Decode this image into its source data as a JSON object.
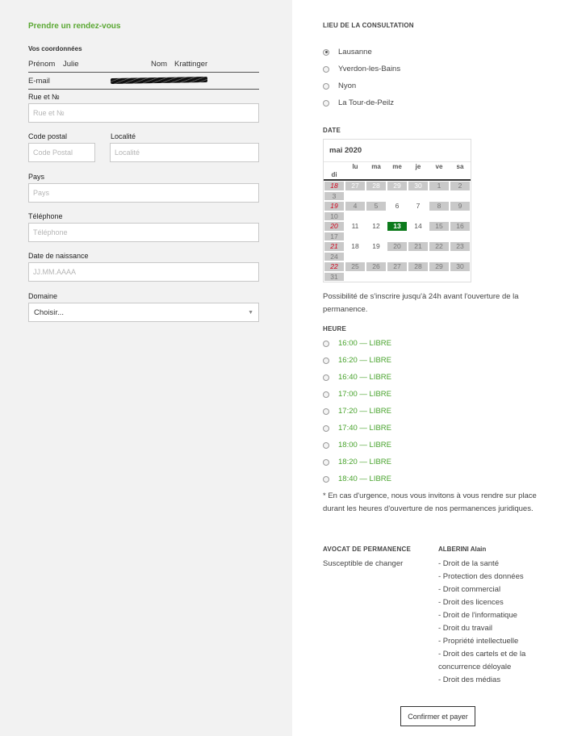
{
  "form": {
    "title": "Prendre un rendez-vous",
    "section": "Vos coordonnées",
    "prenom_label": "Prénom",
    "prenom_value": "Julie",
    "nom_label": "Nom",
    "nom_value": "Krattinger",
    "email_label": "E-mail",
    "rue_label": "Rue et №",
    "rue_placeholder": "Rue et №",
    "cp_label": "Code postal",
    "cp_placeholder": "Code Postal",
    "localite_label": "Localité",
    "localite_placeholder": "Localité",
    "pays_label": "Pays",
    "pays_placeholder": "Pays",
    "tel_label": "Téléphone",
    "tel_placeholder": "Téléphone",
    "dob_label": "Date de naissance",
    "dob_placeholder": "JJ.MM.AAAA",
    "domaine_label": "Domaine",
    "domaine_value": "Choisir..."
  },
  "lieu": {
    "heading": "LIEU DE LA CONSULTATION",
    "options": [
      "Lausanne",
      "Yverdon-les-Bains",
      "Nyon",
      "La Tour-de-Peilz"
    ],
    "selected": "Lausanne"
  },
  "date": {
    "heading": "DATE",
    "month": "mai 2020",
    "weekdays": [
      "lu",
      "ma",
      "me",
      "je",
      "ve",
      "sa",
      "di"
    ],
    "rows": [
      {
        "week": "18",
        "days": [
          "27",
          "28",
          "29",
          "30",
          "1",
          "2",
          "3"
        ]
      },
      {
        "week": "19",
        "days": [
          "4",
          "5",
          "6",
          "7",
          "8",
          "9",
          "10"
        ]
      },
      {
        "week": "20",
        "days": [
          "11",
          "12",
          "13",
          "14",
          "15",
          "16",
          "17"
        ]
      },
      {
        "week": "21",
        "days": [
          "18",
          "19",
          "20",
          "21",
          "22",
          "23",
          "24"
        ]
      },
      {
        "week": "22",
        "days": [
          "25",
          "26",
          "27",
          "28",
          "29",
          "30",
          "31"
        ]
      }
    ],
    "selected_day": "13",
    "note": "Possibilité de s'inscrire jusqu'à 24h avant l'ouverture de la permanence."
  },
  "heure": {
    "heading": "HEURE",
    "slots": [
      "16:00 — LIBRE",
      "16:20 — LIBRE",
      "16:40 — LIBRE",
      "17:00 — LIBRE",
      "17:20 — LIBRE",
      "17:40 — LIBRE",
      "18:00 — LIBRE",
      "18:20 — LIBRE",
      "18:40 — LIBRE"
    ],
    "urgence": "* En cas d'urgence, nous vous invitons à vous rendre sur place durant les heures d'ouverture de nos permanences juridiques."
  },
  "avocat": {
    "heading": "AVOCAT DE PERMANENCE",
    "subtext": "Susceptible de changer",
    "name": "ALBERINI Alain",
    "domains": [
      "- Droit de la santé",
      "- Protection des données",
      "- Droit commercial",
      "- Droit des licences",
      "- Droit de l'informatique",
      "- Droit du travail",
      "- Propriété intellectuelle",
      "- Droit des cartels et de la concurrence déloyale",
      "- Droit des médias"
    ]
  },
  "confirm_label": "Confirmer et payer",
  "colors": {
    "accent": "#5aa832",
    "selected_day": "#0c7a1b",
    "week_number": "#d0021b"
  }
}
